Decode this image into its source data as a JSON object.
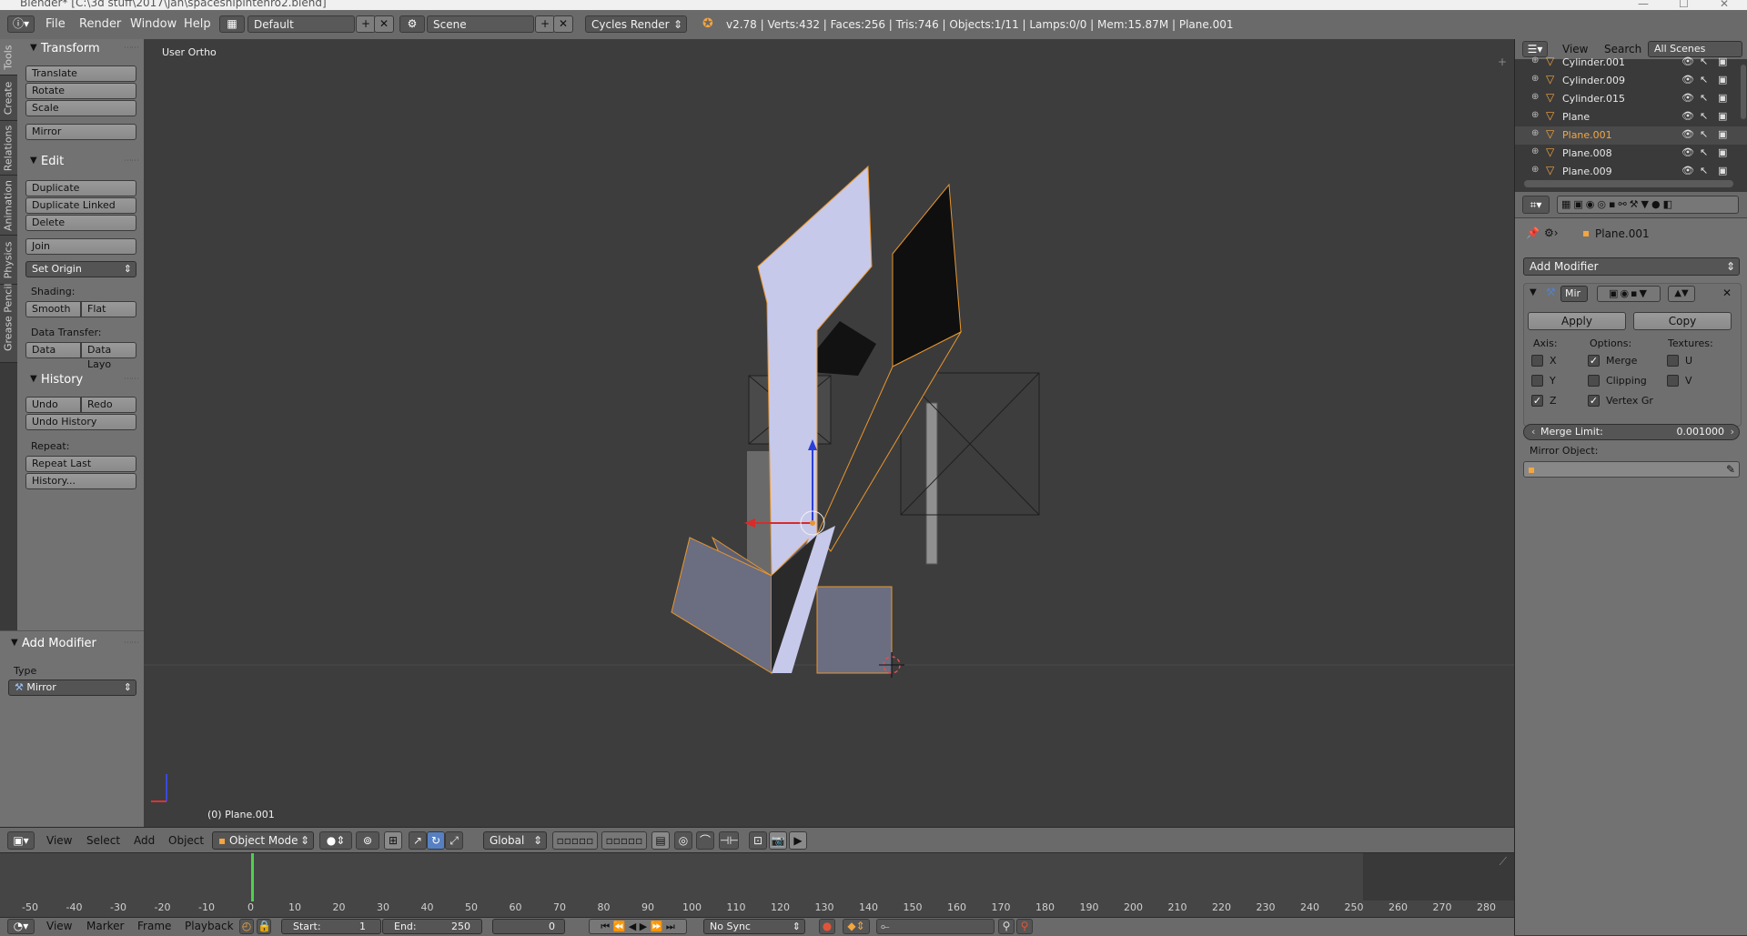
{
  "window_title": "Blender* [C:\\3d stuff\\2017\\jan\\spaceshipintenro2.blend]",
  "info": {
    "menus": [
      "File",
      "Render",
      "Window",
      "Help"
    ],
    "layout": "Default",
    "scene": "Scene",
    "engine": "Cycles Render",
    "stats": "v2.78 | Verts:432 | Faces:256 | Tris:746 | Objects:1/11 | Lamps:0/0 | Mem:15.87M | Plane.001"
  },
  "tabs": [
    "Tools",
    "Create",
    "Relations",
    "Animation",
    "Physics",
    "Grease Pencil"
  ],
  "toolshelf": {
    "transform": {
      "title": "Transform",
      "translate": "Translate",
      "rotate": "Rotate",
      "scale": "Scale",
      "mirror": "Mirror"
    },
    "edit": {
      "title": "Edit",
      "duplicate": "Duplicate",
      "duplicate_linked": "Duplicate Linked",
      "delete": "Delete",
      "join": "Join",
      "set_origin": "Set Origin",
      "shading_label": "Shading:",
      "smooth": "Smooth",
      "flat": "Flat",
      "data_transfer_label": "Data Transfer:",
      "data": "Data",
      "data_layout": "Data Layo"
    },
    "history": {
      "title": "History",
      "undo": "Undo",
      "redo": "Redo",
      "undo_history": "Undo History",
      "repeat_label": "Repeat:",
      "repeat_last": "Repeat Last",
      "history": "History..."
    }
  },
  "operator_panel": {
    "title": "Add Modifier",
    "type_label": "Type",
    "type_value": "Mirror"
  },
  "viewport": {
    "view_label": "User Ortho",
    "object_label": "(0) Plane.001"
  },
  "viewport_header": {
    "menus": [
      "View",
      "Select",
      "Add",
      "Object"
    ],
    "mode": "Object Mode",
    "orientation": "Global"
  },
  "timeline": {
    "ticks": [
      "-50",
      "-40",
      "-30",
      "-20",
      "-10",
      "0",
      "10",
      "20",
      "30",
      "40",
      "50",
      "60",
      "70",
      "80",
      "90",
      "100",
      "110",
      "120",
      "130",
      "140",
      "150",
      "160",
      "170",
      "180",
      "190",
      "200",
      "210",
      "220",
      "230",
      "240",
      "250",
      "260",
      "270",
      "280"
    ],
    "menus": [
      "View",
      "Marker",
      "Frame",
      "Playback"
    ],
    "start_label": "Start:",
    "start": "1",
    "end_label": "End:",
    "end": "250",
    "current": "0",
    "sync": "No Sync"
  },
  "outliner": {
    "menus": [
      "View",
      "Search"
    ],
    "filter": "All Scenes",
    "items": [
      "Cylinder.001",
      "Cylinder.009",
      "Cylinder.015",
      "Plane",
      "Plane.001",
      "Plane.008",
      "Plane.009"
    ]
  },
  "properties": {
    "breadcrumb": "Plane.001",
    "add_modifier": "Add Modifier",
    "modifier_name": "Mir",
    "apply": "Apply",
    "copy": "Copy",
    "axis_label": "Axis:",
    "options_label": "Options:",
    "textures_label": "Textures:",
    "axis": [
      {
        "label": "X",
        "checked": false
      },
      {
        "label": "Y",
        "checked": false
      },
      {
        "label": "Z",
        "checked": true
      }
    ],
    "options": [
      {
        "label": "Merge",
        "checked": true
      },
      {
        "label": "Clipping",
        "checked": false
      },
      {
        "label": "Vertex Gr",
        "checked": true
      }
    ],
    "textures": [
      {
        "label": "U",
        "checked": false
      },
      {
        "label": "V",
        "checked": false
      }
    ],
    "merge_limit_label": "Merge Limit:",
    "merge_limit": "0.001000",
    "mirror_object_label": "Mirror Object:"
  },
  "colors": {
    "selected_outline": "#e8962f",
    "highlight_text": "#f4a640",
    "viewport_bg": "#3d3d3d",
    "panel_bg": "#727272"
  }
}
